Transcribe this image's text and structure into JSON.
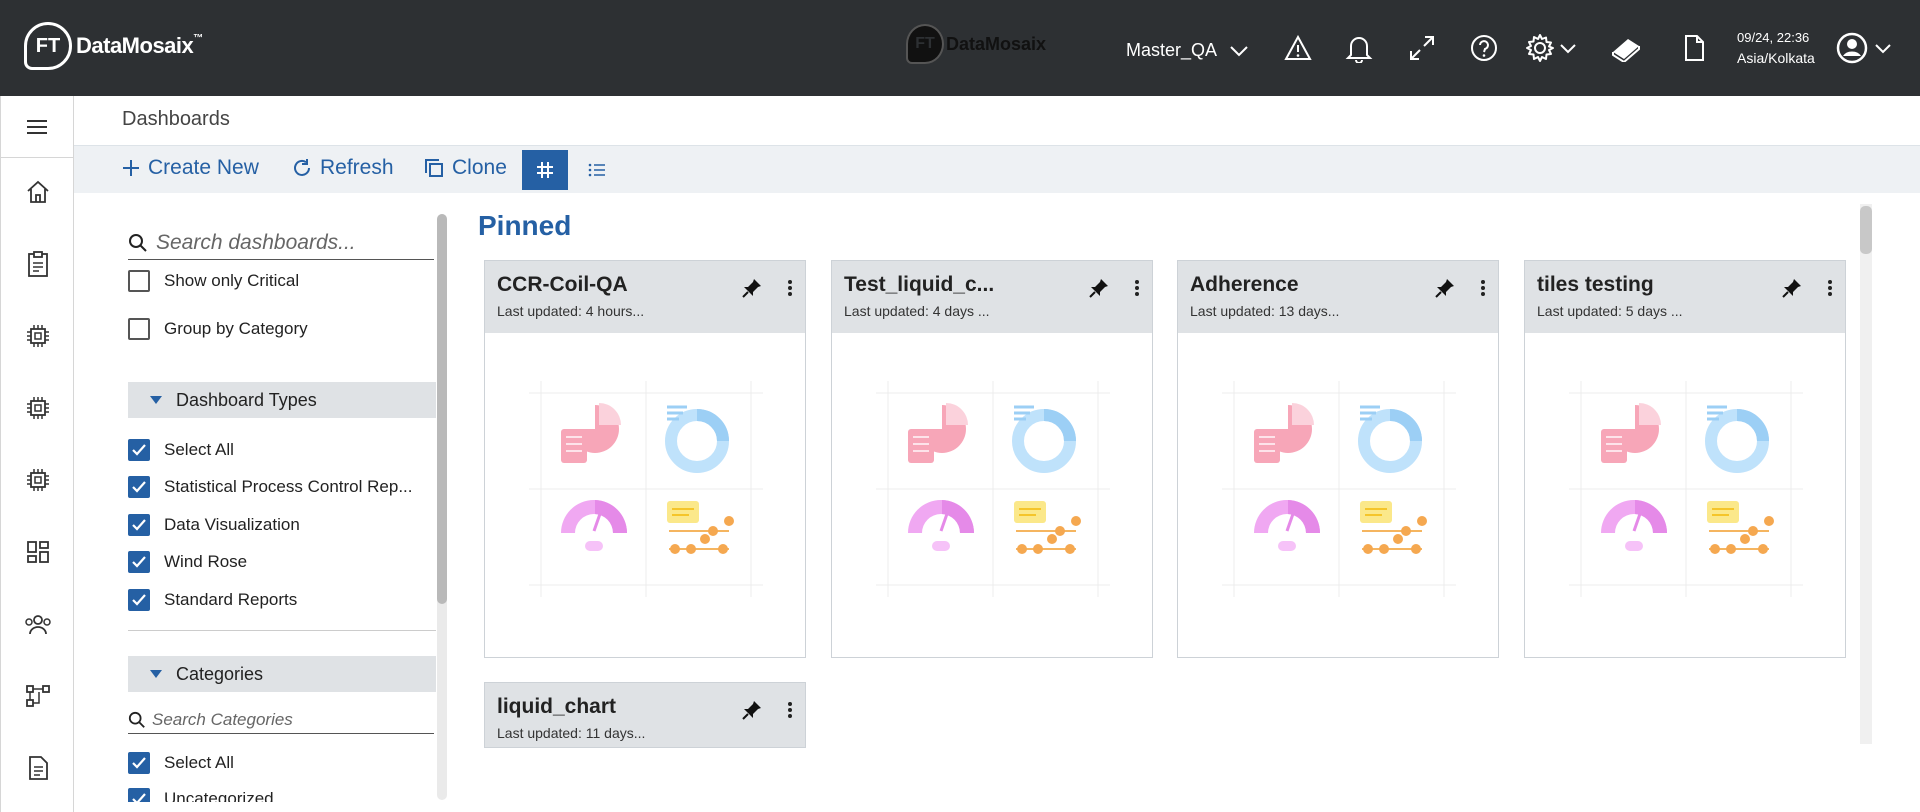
{
  "topbar": {
    "brand_logo": "FT",
    "brand_name": "DataMosaix",
    "brand_tm": "™",
    "center_brand": "DataMosaix",
    "environment": "Master_QA",
    "date": "09/24, 22:36",
    "timezone": "Asia/Kolkata",
    "icons": [
      "warning-icon",
      "bell-icon",
      "expand-icon",
      "help-icon",
      "gear-icon",
      "book-icon",
      "document-icon",
      "user-icon"
    ]
  },
  "rail": {
    "icons": [
      "menu-icon",
      "home-icon",
      "clipboard-icon",
      "chip-icon",
      "chip-icon",
      "chip-icon",
      "layout-icon",
      "users-icon",
      "flow-icon",
      "file-icon"
    ]
  },
  "header": {
    "breadcrumb": "Dashboards"
  },
  "toolbar": {
    "create_new": "Create New",
    "refresh": "Refresh",
    "clone": "Clone"
  },
  "filters": {
    "search_placeholder": "Search dashboards...",
    "show_critical": "Show only Critical",
    "group_category": "Group by Category",
    "types_header": "Dashboard Types",
    "types": [
      "Select All",
      "Statistical Process Control Rep...",
      "Data Visualization",
      "Wind Rose",
      "Standard Reports"
    ],
    "categories_header": "Categories",
    "categories_placeholder": "Search Categories",
    "categories": [
      "Select All",
      "Uncategorized"
    ]
  },
  "main": {
    "pinned_title": "Pinned",
    "cards": [
      {
        "title": "CCR-Coil-QA",
        "updated": "Last updated: 4 hours..."
      },
      {
        "title": "Test_liquid_c...",
        "updated": "Last updated: 4 days ..."
      },
      {
        "title": "Adherence",
        "updated": "Last updated: 13 days..."
      },
      {
        "title": "tiles testing",
        "updated": "Last updated: 5 days ..."
      },
      {
        "title": "liquid_chart",
        "updated": "Last updated: 11 days..."
      }
    ]
  },
  "colors": {
    "topbar_bg": "#2d3033",
    "accent": "#2560a4",
    "card_header": "#dfe2e5"
  }
}
